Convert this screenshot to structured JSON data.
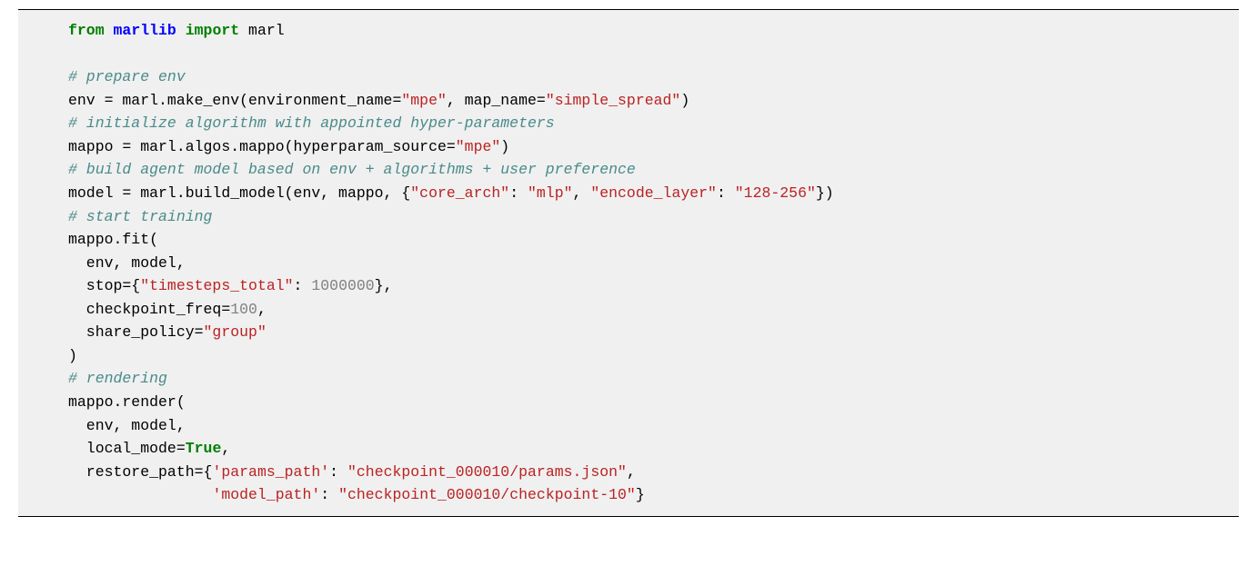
{
  "code": {
    "tokens": [
      {
        "cls": "kw",
        "t": "from"
      },
      {
        "cls": "plain",
        "t": " "
      },
      {
        "cls": "mod",
        "t": "marllib"
      },
      {
        "cls": "plain",
        "t": " "
      },
      {
        "cls": "kw",
        "t": "import"
      },
      {
        "cls": "plain",
        "t": " marl\n"
      },
      {
        "cls": "plain",
        "t": "\n"
      },
      {
        "cls": "comment",
        "t": "# prepare env"
      },
      {
        "cls": "plain",
        "t": "\n"
      },
      {
        "cls": "plain",
        "t": "env = marl.make_env(environment_name="
      },
      {
        "cls": "str",
        "t": "\"mpe\""
      },
      {
        "cls": "plain",
        "t": ", map_name="
      },
      {
        "cls": "str",
        "t": "\"simple_spread\""
      },
      {
        "cls": "plain",
        "t": ")\n"
      },
      {
        "cls": "comment",
        "t": "# initialize algorithm with appointed hyper-parameters"
      },
      {
        "cls": "plain",
        "t": "\n"
      },
      {
        "cls": "plain",
        "t": "mappo = marl.algos.mappo(hyperparam_source="
      },
      {
        "cls": "str",
        "t": "\"mpe\""
      },
      {
        "cls": "plain",
        "t": ")\n"
      },
      {
        "cls": "comment",
        "t": "# build agent model based on env + algorithms + user preference"
      },
      {
        "cls": "plain",
        "t": "\n"
      },
      {
        "cls": "plain",
        "t": "model = marl.build_model(env, mappo, {"
      },
      {
        "cls": "str",
        "t": "\"core_arch\""
      },
      {
        "cls": "plain",
        "t": ": "
      },
      {
        "cls": "str",
        "t": "\"mlp\""
      },
      {
        "cls": "plain",
        "t": ", "
      },
      {
        "cls": "str",
        "t": "\"encode_layer\""
      },
      {
        "cls": "plain",
        "t": ": "
      },
      {
        "cls": "str",
        "t": "\"128-256\""
      },
      {
        "cls": "plain",
        "t": "})\n"
      },
      {
        "cls": "comment",
        "t": "# start training"
      },
      {
        "cls": "plain",
        "t": "\n"
      },
      {
        "cls": "plain",
        "t": "mappo.fit(\n"
      },
      {
        "cls": "plain",
        "t": "  env, model,\n"
      },
      {
        "cls": "plain",
        "t": "  stop={"
      },
      {
        "cls": "str",
        "t": "\"timesteps_total\""
      },
      {
        "cls": "plain",
        "t": ": "
      },
      {
        "cls": "num",
        "t": "1000000"
      },
      {
        "cls": "plain",
        "t": "},\n"
      },
      {
        "cls": "plain",
        "t": "  checkpoint_freq="
      },
      {
        "cls": "num",
        "t": "100"
      },
      {
        "cls": "plain",
        "t": ",\n"
      },
      {
        "cls": "plain",
        "t": "  share_policy="
      },
      {
        "cls": "str",
        "t": "\"group\""
      },
      {
        "cls": "plain",
        "t": "\n"
      },
      {
        "cls": "plain",
        "t": ")\n"
      },
      {
        "cls": "comment",
        "t": "# rendering"
      },
      {
        "cls": "plain",
        "t": "\n"
      },
      {
        "cls": "plain",
        "t": "mappo.render(\n"
      },
      {
        "cls": "plain",
        "t": "  env, model,\n"
      },
      {
        "cls": "plain",
        "t": "  local_mode="
      },
      {
        "cls": "bool",
        "t": "True"
      },
      {
        "cls": "plain",
        "t": ",\n"
      },
      {
        "cls": "plain",
        "t": "  restore_path={"
      },
      {
        "cls": "str",
        "t": "'params_path'"
      },
      {
        "cls": "plain",
        "t": ": "
      },
      {
        "cls": "str",
        "t": "\"checkpoint_000010/params.json\""
      },
      {
        "cls": "plain",
        "t": ",\n"
      },
      {
        "cls": "plain",
        "t": "                "
      },
      {
        "cls": "str",
        "t": "'model_path'"
      },
      {
        "cls": "plain",
        "t": ": "
      },
      {
        "cls": "str",
        "t": "\"checkpoint_000010/checkpoint-10\""
      },
      {
        "cls": "plain",
        "t": "}"
      }
    ]
  }
}
